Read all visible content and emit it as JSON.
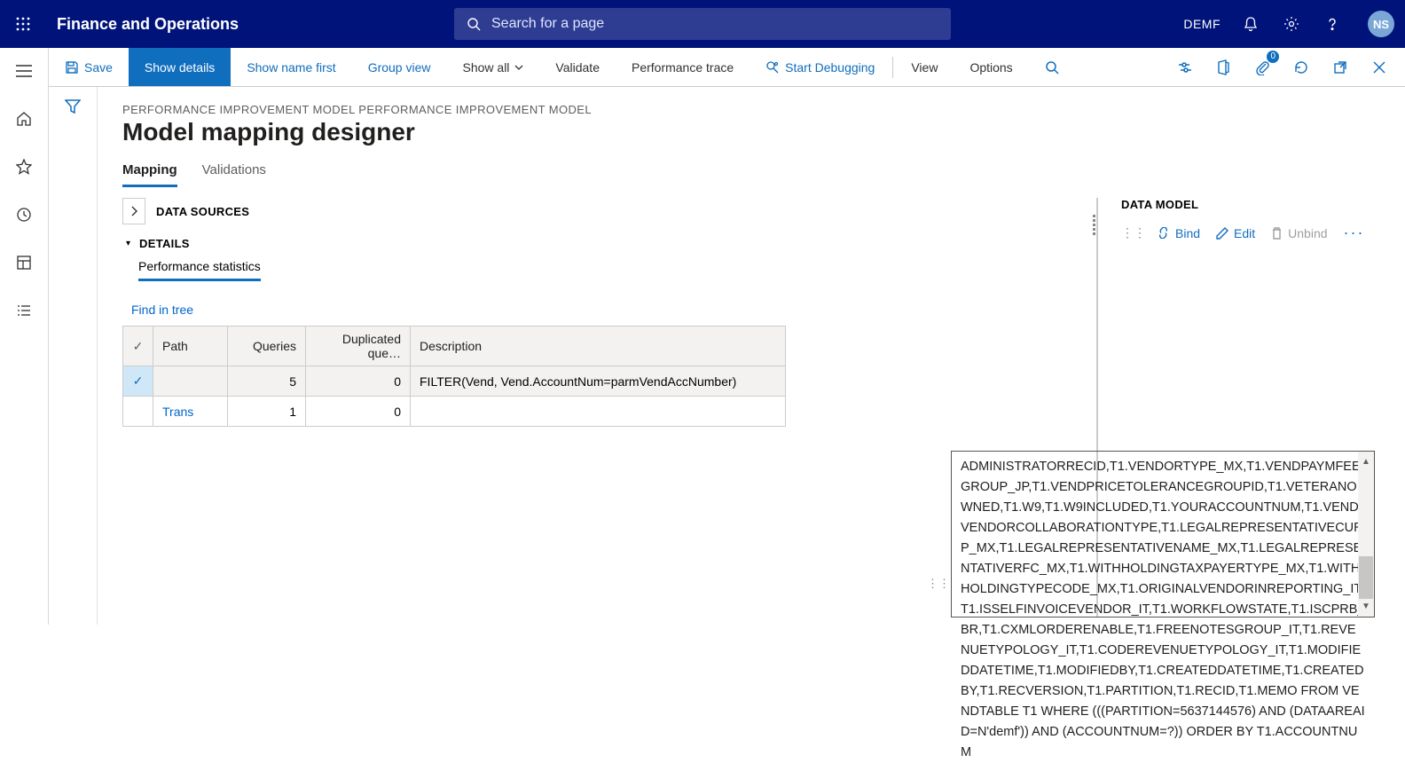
{
  "topbar": {
    "app_title": "Finance and Operations",
    "search_placeholder": "Search for a page",
    "company": "DEMF",
    "avatar": "NS"
  },
  "actionbar": {
    "save": "Save",
    "show_details": "Show details",
    "show_name_first": "Show name first",
    "group_view": "Group view",
    "show_all": "Show all",
    "validate": "Validate",
    "perf_trace": "Performance trace",
    "start_debugging": "Start Debugging",
    "view": "View",
    "options": "Options",
    "badge": "0"
  },
  "page": {
    "breadcrumb": "PERFORMANCE IMPROVEMENT MODEL PERFORMANCE IMPROVEMENT MODEL",
    "title": "Model mapping designer",
    "tabs": {
      "mapping": "Mapping",
      "validations": "Validations"
    },
    "data_sources": "DATA SOURCES",
    "details": "DETAILS",
    "perf_stats": "Performance statistics",
    "find_in_tree": "Find in tree"
  },
  "table": {
    "cols": {
      "path": "Path",
      "queries": "Queries",
      "dup": "Duplicated que…",
      "desc": "Description"
    },
    "rows": [
      {
        "path": "",
        "queries": "5",
        "dup": "0",
        "desc": "FILTER(Vend, Vend.AccountNum=parmVendAccNumber)",
        "selected": true
      },
      {
        "path": "Trans",
        "queries": "1",
        "dup": "0",
        "desc": "",
        "selected": false
      }
    ]
  },
  "datamodel": {
    "title": "DATA MODEL",
    "bind": "Bind",
    "edit": "Edit",
    "unbind": "Unbind"
  },
  "sql": "ADMINISTRATORRECID,T1.VENDORTYPE_MX,T1.VENDPAYMFEEGROUP_JP,T1.VENDPRICETOLERANCEGROUPID,T1.VETERANOWNED,T1.W9,T1.W9INCLUDED,T1.YOURACCOUNTNUM,T1.VENDVENDORCOLLABORATIONTYPE,T1.LEGALREPRESENTATIVECURP_MX,T1.LEGALREPRESENTATIVENAME_MX,T1.LEGALREPRESENTATIVERFC_MX,T1.WITHHOLDINGTAXPAYERTYPE_MX,T1.WITHHOLDINGTYPECODE_MX,T1.ORIGINALVENDORINREPORTING_IT,T1.ISSELFINVOICEVENDOR_IT,T1.WORKFLOWSTATE,T1.ISCPRB_BR,T1.CXMLORDERENABLE,T1.FREENOTESGROUP_IT,T1.REVENUETYPOLOGY_IT,T1.CODEREVENUETYPOLOGY_IT,T1.MODIFIEDDATETIME,T1.MODIFIEDBY,T1.CREATEDDATETIME,T1.CREATEDBY,T1.RECVERSION,T1.PARTITION,T1.RECID,T1.MEMO FROM VENDTABLE T1 WHERE (((PARTITION=5637144576) AND (DATAAREAID=N'demf')) AND (ACCOUNTNUM=?)) ORDER BY T1.ACCOUNTNUM"
}
